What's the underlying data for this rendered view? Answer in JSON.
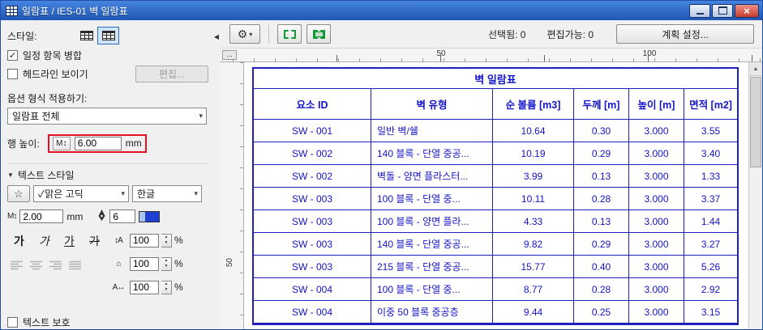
{
  "window": {
    "title": "일람표 / IES-01 벽 일람표"
  },
  "icons": {
    "check": "✓",
    "collapse": "◀",
    "gear": "⚙",
    "dropdown": "▾",
    "star": "☆",
    "section_arrow": "▼",
    "letter_height": "M↕",
    "line_spacing": "↕A",
    "char_width": "⌂",
    "char_spacing": "A↔",
    "spin_up": "▲",
    "spin_down": "▼",
    "scroll_up": "▲",
    "close": "×"
  },
  "sidebar": {
    "style_label": "스타일:",
    "checkbox_merge": "일정 항목 병합",
    "checkbox_headline": "헤드라인 보이기",
    "edit_button": "편집...",
    "option_format_label": "옵션 형식 적용하기:",
    "scheme_value": "일람표 전체",
    "row_height": {
      "label": "행 높이:",
      "value": "6.00",
      "unit": "mm"
    },
    "text_style_header": "텍스트 스타일",
    "font": {
      "display": "✓맑은 고딕",
      "script": "한글"
    },
    "font_size": {
      "value": "2.00",
      "unit": "mm"
    },
    "pen": {
      "value": "6"
    },
    "style_buttons": {
      "bold": "가",
      "italic": "가",
      "underline": "가",
      "strike": "가"
    },
    "spacing": [
      {
        "value": "100",
        "unit": "%"
      },
      {
        "value": "100",
        "unit": "%"
      },
      {
        "value": "100",
        "unit": "%"
      }
    ],
    "checkbox_protect": "텍스트 보호"
  },
  "toolbar": {
    "selected": "선택됨: 0",
    "editable": "편집가능: 0",
    "plan_settings": "계획 설정..."
  },
  "ruler": {
    "corner": "...",
    "h_labels": [
      "50",
      "100"
    ],
    "v_labels": [
      "50"
    ]
  },
  "table": {
    "title": "벽 일람표",
    "headers": [
      "요소 ID",
      "벽 유형",
      "순 볼륨 [m3]",
      "두께 [m]",
      "높이 [m]",
      "면적 [m2]"
    ],
    "rows": [
      [
        "SW - 001",
        "일반 벽/쉘",
        "10.64",
        "0.30",
        "3.000",
        "3.55"
      ],
      [
        "SW - 002",
        "140 블록 - 단열 중공...",
        "10.19",
        "0.29",
        "3.000",
        "3.40"
      ],
      [
        "SW - 002",
        "벽돌 - 양면 플라스터...",
        "3.99",
        "0.13",
        "3.000",
        "1.33"
      ],
      [
        "SW - 003",
        "100 블록 - 단열 중...",
        "10.11",
        "0.28",
        "3.000",
        "3.37"
      ],
      [
        "SW - 003",
        "100 블록 - 양면 플라...",
        "4.33",
        "0.13",
        "3.000",
        "1.44"
      ],
      [
        "SW - 003",
        "140 블록 - 단열 중공...",
        "9.82",
        "0.29",
        "3.000",
        "3.27"
      ],
      [
        "SW - 003",
        "215 블록 - 단열 중공...",
        "15.77",
        "0.40",
        "3.000",
        "5.26"
      ],
      [
        "SW - 004",
        "100 블록 - 단열 중...",
        "8.77",
        "0.28",
        "3.000",
        "2.92"
      ],
      [
        "SW - 004",
        "이중 50 블록 중공층",
        "9.44",
        "0.25",
        "3.000",
        "3.15"
      ]
    ]
  }
}
